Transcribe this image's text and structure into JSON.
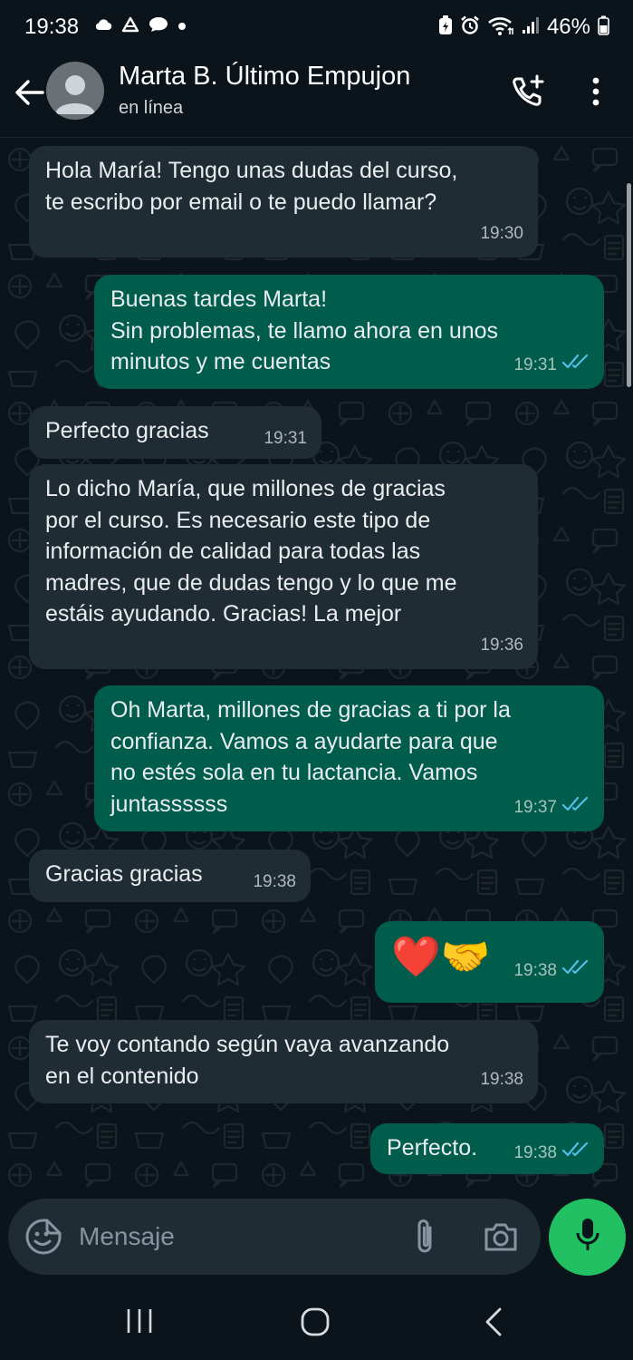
{
  "status_bar": {
    "time": "19:38",
    "battery": "46%",
    "left_icons": [
      "cloud-icon",
      "drive-icon",
      "chat-bubble-icon",
      "dot-icon"
    ],
    "right_icons": [
      "battery-saver-icon",
      "alarm-icon",
      "wifi-icon",
      "signal-icon",
      "battery-icon"
    ]
  },
  "header": {
    "contact_name": "Marta B. Último Empujon",
    "contact_status": "en línea",
    "icons": [
      "back-arrow-icon",
      "avatar-icon",
      "add-call-icon",
      "more-vert-icon"
    ]
  },
  "messages": [
    {
      "direction": "in",
      "text": "Hola María! Tengo unas dudas del curso,\nte escribo por email o te puedo llamar?",
      "time": "19:30"
    },
    {
      "direction": "out",
      "text": "Buenas tardes Marta!\nSin problemas, te llamo ahora en unos\nminutos y me cuentas",
      "time": "19:31",
      "read": true
    },
    {
      "direction": "in",
      "text": "Perfecto gracias",
      "time": "19:31"
    },
    {
      "direction": "in",
      "text": "Lo dicho María, que millones de gracias\npor el curso. Es necesario este tipo de\ninformación de calidad para todas las\nmadres, que de dudas tengo y lo que me\nestáis ayudando. Gracias! La mejor",
      "time": "19:36"
    },
    {
      "direction": "out",
      "text": "Oh Marta, millones de gracias a ti por la\nconfianza. Vamos a ayudarte para que\nno estés sola en tu lactancia. Vamos\njuntassssss",
      "time": "19:37",
      "read": true
    },
    {
      "direction": "in",
      "text": "Gracias gracias",
      "time": "19:38"
    },
    {
      "direction": "out",
      "text": "❤️🤝",
      "time": "19:38",
      "read": true,
      "emoji_only": true
    },
    {
      "direction": "in",
      "text": "Te voy contando según vaya avanzando\nen el contenido",
      "time": "19:38"
    },
    {
      "direction": "out",
      "text": "Perfecto.",
      "time": "19:38",
      "read": true
    }
  ],
  "input_bar": {
    "placeholder": "Mensaje",
    "icons": [
      "sticker-emoji-icon",
      "paperclip-icon",
      "camera-icon",
      "mic-icon"
    ]
  },
  "nav_bar": {
    "icons": [
      "recent-apps-icon",
      "home-icon",
      "back-icon"
    ]
  },
  "colors": {
    "background": "#0b141a",
    "incoming_bubble": "#202c33",
    "outgoing_bubble": "#005c4b",
    "read_ticks": "#53bdeb",
    "mic_button": "#21c063"
  }
}
